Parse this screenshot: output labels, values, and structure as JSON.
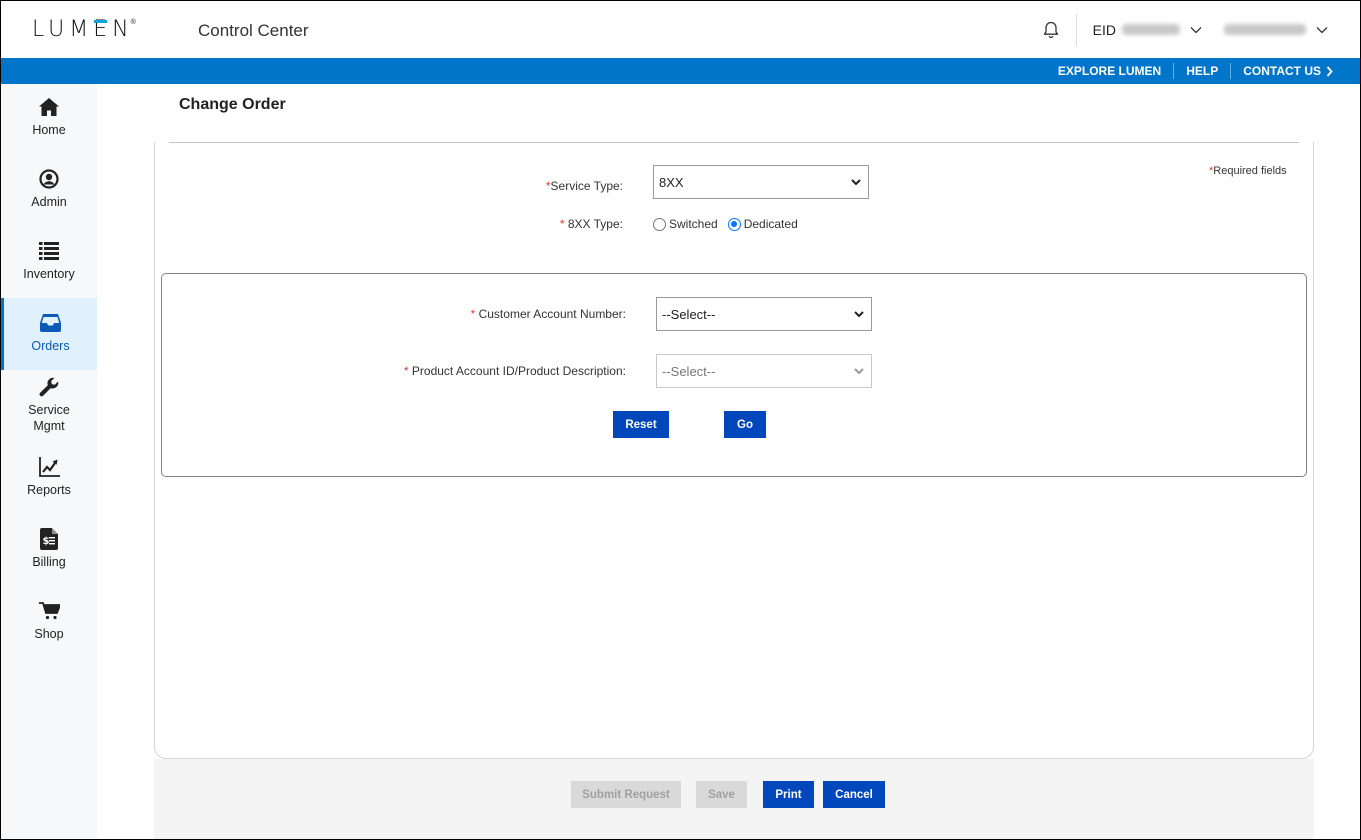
{
  "header": {
    "logo_text": "LUMEN",
    "logo_mark": "®",
    "app_title": "Control Center",
    "eid_label": "EID",
    "icons": {
      "notifications": "bell-icon",
      "eid_menu": "chevron-down-icon",
      "user_menu": "chevron-down-icon"
    }
  },
  "utility_nav": {
    "links": [
      {
        "label": "EXPLORE LUMEN"
      },
      {
        "label": "HELP"
      },
      {
        "label": "CONTACT US"
      }
    ]
  },
  "sidebar": {
    "items": [
      {
        "label": "Home",
        "icon": "home-icon",
        "active": false
      },
      {
        "label": "Admin",
        "icon": "user-circle-icon",
        "active": false
      },
      {
        "label": "Inventory",
        "icon": "list-icon",
        "active": false
      },
      {
        "label": "Orders",
        "icon": "inbox-icon",
        "active": true
      },
      {
        "label": "Service Mgmt",
        "icon": "wrench-icon",
        "active": false
      },
      {
        "label": "Reports",
        "icon": "chart-line-icon",
        "active": false
      },
      {
        "label": "Billing",
        "icon": "invoice-dollar-icon",
        "active": false
      },
      {
        "label": "Shop",
        "icon": "cart-icon",
        "active": false
      }
    ]
  },
  "page": {
    "title": "Change Order",
    "required_note": "Required fields",
    "required_marker": "*"
  },
  "form": {
    "service_type": {
      "label": "Service Type:",
      "value": "8XX"
    },
    "type_8xx": {
      "label": "8XX Type:",
      "options": [
        {
          "label": "Switched",
          "checked": false
        },
        {
          "label": "Dedicated",
          "checked": true
        }
      ]
    },
    "customer_account": {
      "label": "Customer Account Number:",
      "value": "--Select--",
      "disabled": false
    },
    "product_account": {
      "label": "Product Account ID/Product Description:",
      "value": "--Select--",
      "disabled": true
    },
    "reset_label": "Reset",
    "go_label": "Go"
  },
  "footer": {
    "submit_label": "Submit Request",
    "save_label": "Save",
    "print_label": "Print",
    "cancel_label": "Cancel",
    "submit_enabled": false,
    "save_enabled": false
  },
  "colors": {
    "brand_blue": "#0075c9",
    "button_blue": "#0047bb",
    "active_nav_bg": "#e0f0fc",
    "required_red": "#e53935",
    "logo_accent": "#0ea3d9"
  }
}
